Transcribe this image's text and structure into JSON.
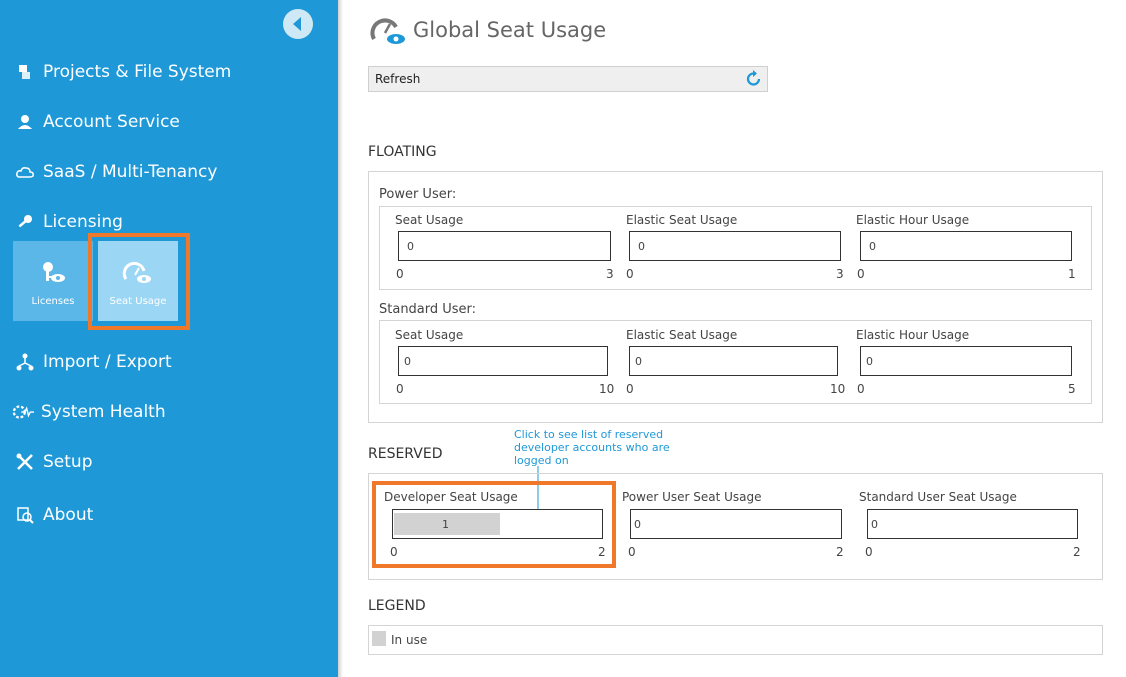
{
  "sidebar": {
    "items": [
      {
        "label": "Projects & File System",
        "icon": "projects-icon"
      },
      {
        "label": "Account Service",
        "icon": "user-icon"
      },
      {
        "label": "SaaS / Multi-Tenancy",
        "icon": "cloud-icon"
      },
      {
        "label": "Licensing",
        "icon": "key-icon"
      },
      {
        "label": "Import / Export",
        "icon": "import-export-icon"
      },
      {
        "label": "System Health",
        "icon": "health-icon"
      },
      {
        "label": "Setup",
        "icon": "tools-icon"
      },
      {
        "label": "About",
        "icon": "about-icon"
      }
    ],
    "subtiles": [
      {
        "label": "Licenses",
        "icon": "key-eye-icon"
      },
      {
        "label": "Seat Usage",
        "icon": "gauge-eye-icon",
        "active": true
      }
    ],
    "background": "#1e98d7",
    "active_tile": "#9bd6f5",
    "highlight": "#f0782a"
  },
  "page": {
    "title": "Global Seat Usage",
    "refresh_label": "Refresh"
  },
  "floating": {
    "heading": "FLOATING",
    "groups": [
      {
        "label": "Power User:",
        "fields": [
          {
            "label": "Seat Usage",
            "value": "0",
            "min": "0",
            "max": "3"
          },
          {
            "label": "Elastic Seat Usage",
            "value": "0",
            "min": "0",
            "max": "3"
          },
          {
            "label": "Elastic Hour Usage",
            "value": "0",
            "min": "0",
            "max": "1"
          }
        ]
      },
      {
        "label": "Standard User:",
        "fields": [
          {
            "label": "Seat Usage",
            "value": "0",
            "min": "0",
            "max": "10"
          },
          {
            "label": "Elastic Seat Usage",
            "value": "0",
            "min": "0",
            "max": "10"
          },
          {
            "label": "Elastic Hour Usage",
            "value": "0",
            "min": "0",
            "max": "5"
          }
        ]
      }
    ]
  },
  "reserved": {
    "heading": "RESERVED",
    "callout": "Click to see list of reserved developer accounts who are logged on",
    "fields": [
      {
        "label": "Developer Seat Usage",
        "value": "1",
        "min": "0",
        "max": "2",
        "fill_fraction": 0.5
      },
      {
        "label": "Power User Seat Usage",
        "value": "0",
        "min": "0",
        "max": "2"
      },
      {
        "label": "Standard User Seat Usage",
        "value": "0",
        "min": "0",
        "max": "2"
      }
    ]
  },
  "legend": {
    "heading": "LEGEND",
    "in_use": "In use",
    "in_use_color": "#d2d2d2"
  }
}
